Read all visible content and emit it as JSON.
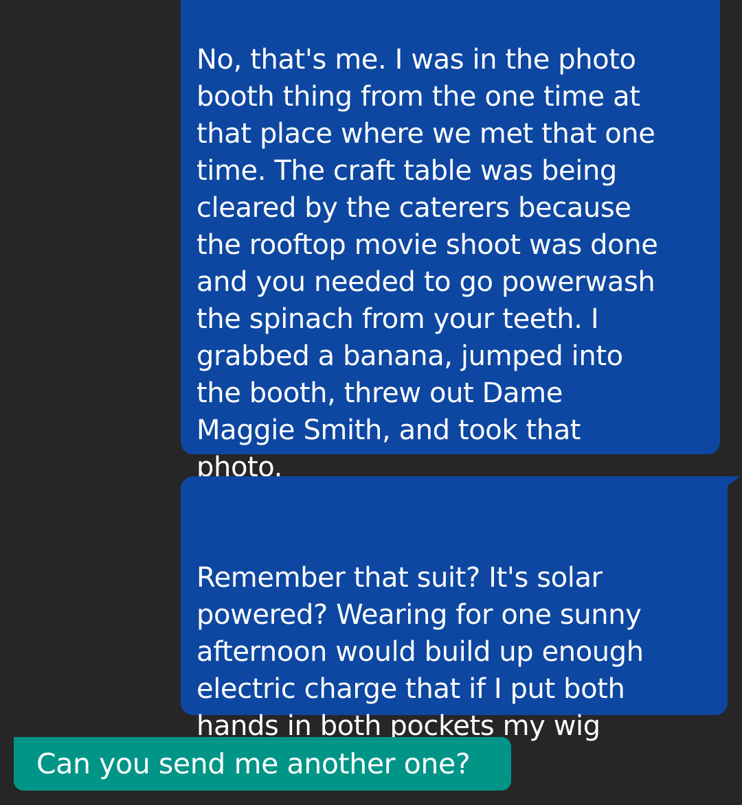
{
  "conversation": {
    "messages": [
      {
        "direction": "sent",
        "text": "No, that's me.  I was in the photo\nbooth thing from the one time at\nthat place where we met that one\ntime.  The craft table was being\ncleared by the caterers because\nthe rooftop movie shoot was done\nand you needed to go powerwash\nthe spinach from your teeth.  I\ngrabbed a banana, jumped into\nthe booth, threw out Dame\nMaggie Smith, and took that\nphoto."
      },
      {
        "direction": "sent",
        "text": "Remember that suit?  It's solar\npowered?  Wearing for one sunny\nafternoon would build up enough\nelectric charge that if I put both\nhands in both pockets my wig\nwould catch on fire."
      },
      {
        "direction": "received",
        "text": "Can you send me another one?"
      }
    ]
  },
  "colors": {
    "background": "#262626",
    "sent_bubble": "#0d47a1",
    "received_bubble": "#009587",
    "text": "#ffffff"
  }
}
